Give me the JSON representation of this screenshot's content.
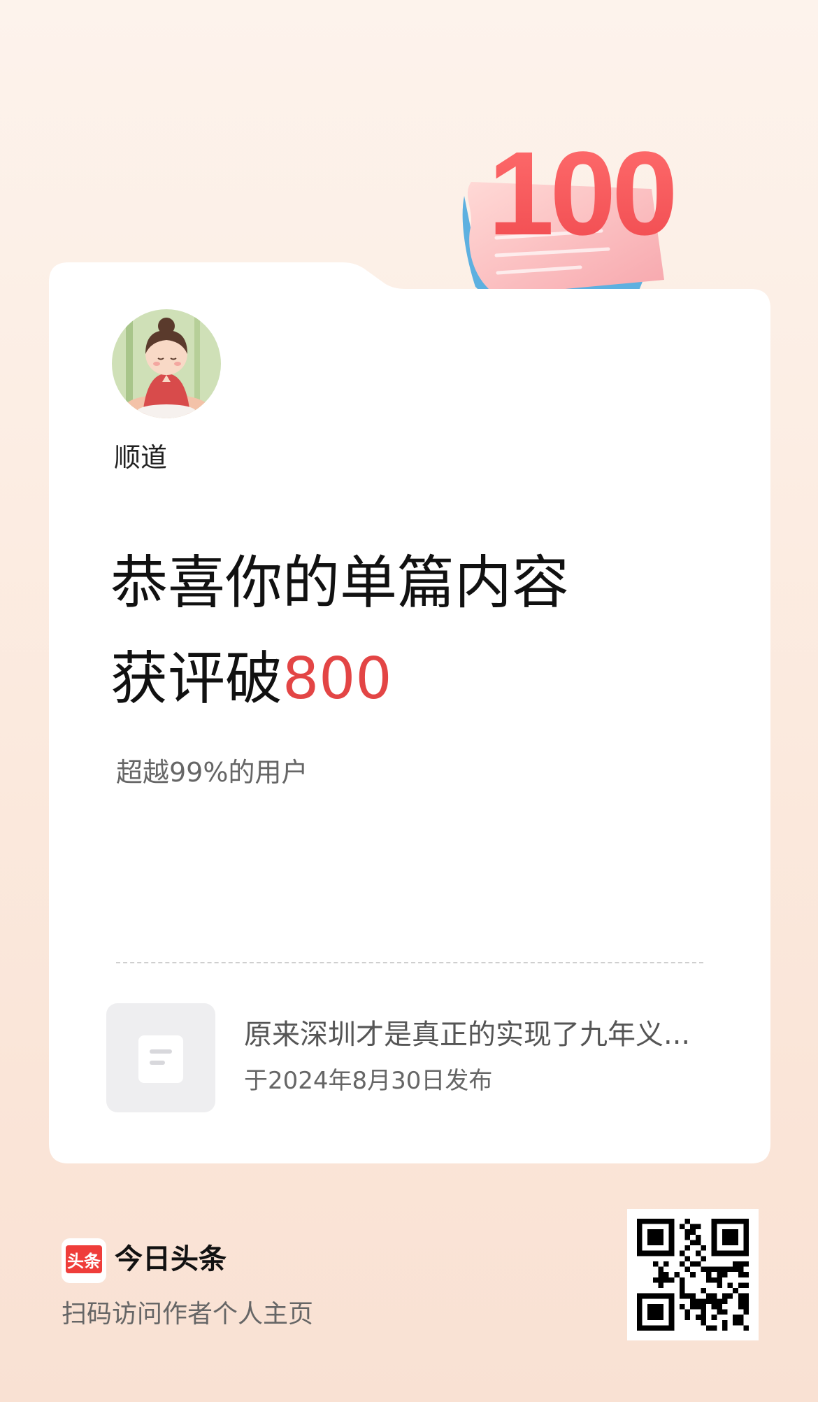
{
  "badge": {
    "number": "100"
  },
  "card": {
    "username": "顺道",
    "headline_line1": "恭喜你的单篇内容",
    "headline_line2_prefix": "获评破",
    "headline_line2_number": "800",
    "subline": "超越99%的用户",
    "article": {
      "title": "原来深圳才是真正的实现了九年义...",
      "published": "于2024年8月30日发布"
    }
  },
  "footer": {
    "logo_text": "头条",
    "app_name": "今日头条",
    "scan_text": "扫码访问作者个人主页"
  },
  "colors": {
    "accent": "#e34545",
    "logo_red": "#ef3d3a",
    "background": "#fbe9dd"
  }
}
